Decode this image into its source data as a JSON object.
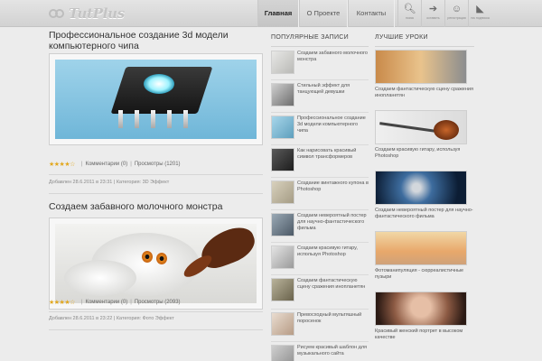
{
  "header": {
    "logo": "TutPlus",
    "nav": [
      "Главная",
      "О Проекте",
      "Контакты"
    ],
    "tools": [
      {
        "label": "поиск",
        "icon": "search-icon"
      },
      {
        "label": "оставить",
        "icon": "arrow-right-icon"
      },
      {
        "label": "регистрация",
        "icon": "users-icon"
      },
      {
        "label": "rss подписка",
        "icon": "rss-icon"
      }
    ]
  },
  "posts": [
    {
      "title": "Профессиональное создание 3d модели компьютерного чипа",
      "comments": "Комментарии (0)",
      "views": "Просмотры (1201)",
      "meta": "Добавлен 28.6.2011 в 23:31 | Категория: 3D Эффект",
      "rating": 4.5
    },
    {
      "title": "Создаем забавного молочного монстра",
      "comments": "Комментарии (0)",
      "views": "Просмотры (2093)",
      "meta": "Добавлен 28.6.2011 в 23:22 | Категория: Фото Эффект",
      "rating": 4.5
    }
  ],
  "popular": {
    "heading": "Популярные записи",
    "items": [
      "Создаем забавного молочного монстра",
      "Стильный эффект для танцующей девушки",
      "Профессиональное создание 3d модели компьютерного чипа",
      "Как нарисовать красивый символ трансформеров",
      "Создание винтажного купона в Photoshop",
      "Создаем невероятный постер для научно-фантастического фильма",
      "Создаем красивую гитару, используя Photoshop",
      "Создаем фантастическую сцену сражения инопланетян",
      "Превосходный мультяшный поросенок",
      "Рисуем красивый шаблон для музыкального сайта"
    ]
  },
  "best": {
    "heading": "Лучшие уроки",
    "items": [
      "Создаем фантастическую сцену сражения инопланетян",
      "Создаем красивую гитару, используя Photoshop",
      "Создаем невероятный постер для научно-фантастического фильма",
      "Фотоманипуляция - сюрреалистичные пузыри",
      "Красивый женский портрет в высоком качестве"
    ]
  },
  "colors": {
    "accent_star": "#e2a81f",
    "page_bg": "#ececec"
  }
}
